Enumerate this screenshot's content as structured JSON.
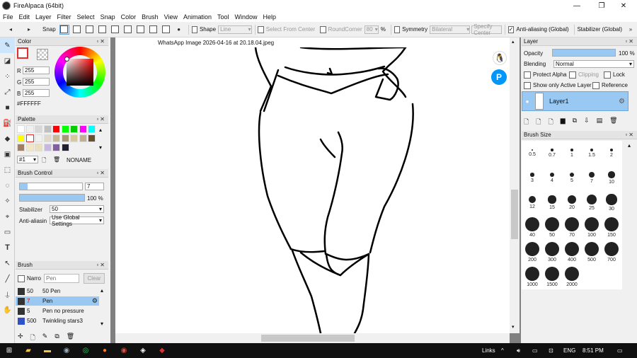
{
  "app": {
    "title": "FireAlpaca (64bit)"
  },
  "window_controls": {
    "minimize": "—",
    "maximize": "❐",
    "close": "✕"
  },
  "menu": [
    "File",
    "Edit",
    "Layer",
    "Filter",
    "Select",
    "Snap",
    "Color",
    "Brush",
    "View",
    "Animation",
    "Tool",
    "Window",
    "Help"
  ],
  "toolbar": {
    "snap_label": "Snap",
    "shape_label": "Shape",
    "shape_value": "Line",
    "select_from_center": "Select From Center",
    "round_corner": "RoundCorner",
    "round_corner_value": "80",
    "percent": "%",
    "symmetry": "Symmetry",
    "symmetry_value": "Bilateral",
    "specify_center": "Specify Center",
    "antialias_global": "Anti-aliasing (Global)",
    "stabilizer_global": "Stabilizer (Global)"
  },
  "color_panel": {
    "title": "Color",
    "r_label": "R",
    "r_value": "255",
    "g_label": "G",
    "g_value": "255",
    "b_label": "B",
    "b_value": "255",
    "hex": "#FFFFFF"
  },
  "palette_panel": {
    "title": "Palette",
    "swatches_row1": [
      "#ffffff",
      "#f0f0f0",
      "#d8d8d8",
      "#c0c0c0",
      "#ff0000",
      "#00ff00",
      "#00cc00",
      "#ff00ff",
      "#00ffff"
    ],
    "swatches_row2": [
      "#ffff00",
      "#ffffff",
      "#f0f0f0",
      "#e0d8c8",
      "#c8b896",
      "#a89878",
      "#d8c8a0",
      "#c0b090",
      "#6b5030"
    ],
    "swatches_row3": [
      "#a08060",
      "#f0e8c8",
      "#e8e0c0",
      "#c8b8e0",
      "#8060a0",
      "#202030"
    ],
    "palette_index": "#1",
    "palette_name": "NONAME"
  },
  "brush_control": {
    "title": "Brush Control",
    "size_value": "7",
    "opacity_value": "100 %",
    "opacity_fraction": 1.0,
    "stabilizer_label": "Stabilizer",
    "stabilizer_value": "50",
    "antialias_label": "Anti-aliasin",
    "antialias_value": "Use Global Settings"
  },
  "brush_panel": {
    "title": "Brush",
    "narrow_label": "Narro",
    "filter_placeholder": "Pen",
    "clear_label": "Clear",
    "items": [
      {
        "size": "50",
        "name": "50 Pen",
        "color": "#333333",
        "selected": false
      },
      {
        "size": "7",
        "name": "Pen",
        "color": "#333333",
        "selected": true
      },
      {
        "size": "5",
        "name": "Pen no pressure",
        "color": "#333333",
        "selected": false
      },
      {
        "size": "500",
        "name": "Twinkling stars3",
        "color": "#3050c8",
        "selected": false
      }
    ]
  },
  "document": {
    "tab_name": "WhatsApp Image 2026-04-16 at 20.18.04.jpeg"
  },
  "layer_panel": {
    "title": "Layer",
    "opacity_label": "Opacity",
    "opacity_value": "100 %",
    "opacity_fraction": 1.0,
    "blending_label": "Blending",
    "blending_value": "Normal",
    "protect_alpha": "Protect Alpha",
    "clipping": "Clipping",
    "lock": "Lock",
    "show_only_active": "Show only Active Layer",
    "reference": "Reference",
    "layer_name": "Layer1"
  },
  "brush_size_panel": {
    "title": "Brush Size",
    "sizes": [
      "0.5",
      "0.7",
      "1",
      "1.5",
      "2",
      "3",
      "4",
      "5",
      "7",
      "10",
      "12",
      "15",
      "20",
      "25",
      "30",
      "40",
      "50",
      "70",
      "100",
      "150",
      "200",
      "300",
      "400",
      "500",
      "700",
      "1000",
      "1500",
      "2000"
    ]
  },
  "taskbar": {
    "links_label": "Links",
    "language": "ENG",
    "time": "8:51 PM"
  },
  "colors": {
    "accent": "#99c9f2",
    "selection": "#cde6fb",
    "taskbar": "#101010"
  }
}
